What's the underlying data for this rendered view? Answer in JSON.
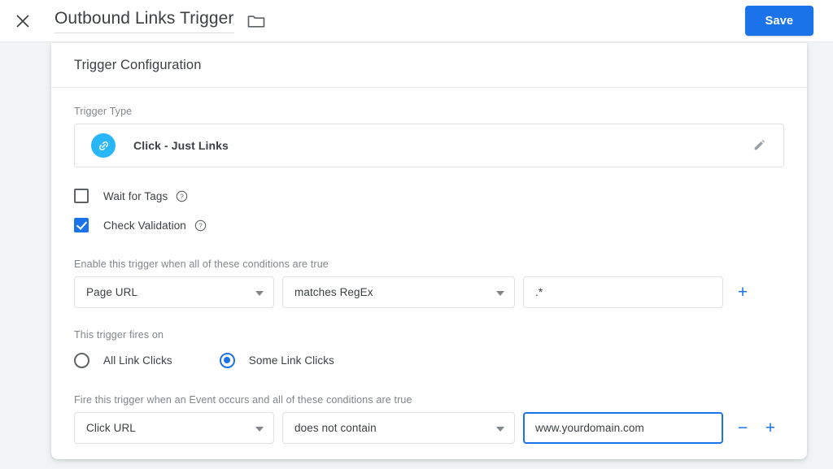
{
  "header": {
    "close_icon": "close-icon",
    "title": "Outbound Links Trigger",
    "folder_icon": "folder-icon",
    "save_label": "Save"
  },
  "colors": {
    "accent_blue": "#1a73e8",
    "trigger_icon_blue": "#29b6f6",
    "page_background": "#f1f3f4",
    "text_primary": "#3c4043",
    "text_secondary": "#80868b"
  },
  "card": {
    "section_title": "Trigger Configuration",
    "trigger_type": {
      "label": "Trigger Type",
      "icon": "link-icon",
      "value": "Click - Just Links",
      "edit_icon": "pencil-icon"
    },
    "checkboxes": [
      {
        "label": "Wait for Tags",
        "checked": false,
        "help_icon": "help-circle-icon"
      },
      {
        "label": "Check Validation",
        "checked": true,
        "help_icon": "help-circle-icon"
      }
    ],
    "enable_conditions": {
      "label": "Enable this trigger when all of these conditions are true",
      "rows": [
        {
          "variable": "Page URL",
          "operator": "matches RegEx",
          "value": ".*",
          "value_placeholder": "",
          "focused": false,
          "add_label": "+",
          "remove_label": ""
        }
      ]
    },
    "fires_on": {
      "label": "This trigger fires on",
      "options": [
        {
          "label": "All Link Clicks",
          "selected": false
        },
        {
          "label": "Some Link Clicks",
          "selected": true
        }
      ]
    },
    "event_conditions": {
      "label": "Fire this trigger when an Event occurs and all of these conditions are true",
      "rows": [
        {
          "variable": "Click URL",
          "operator": "does not contain",
          "value": "www.yourdomain.com",
          "value_placeholder": "",
          "focused": true,
          "remove_label": "−",
          "add_label": "+"
        }
      ]
    }
  }
}
